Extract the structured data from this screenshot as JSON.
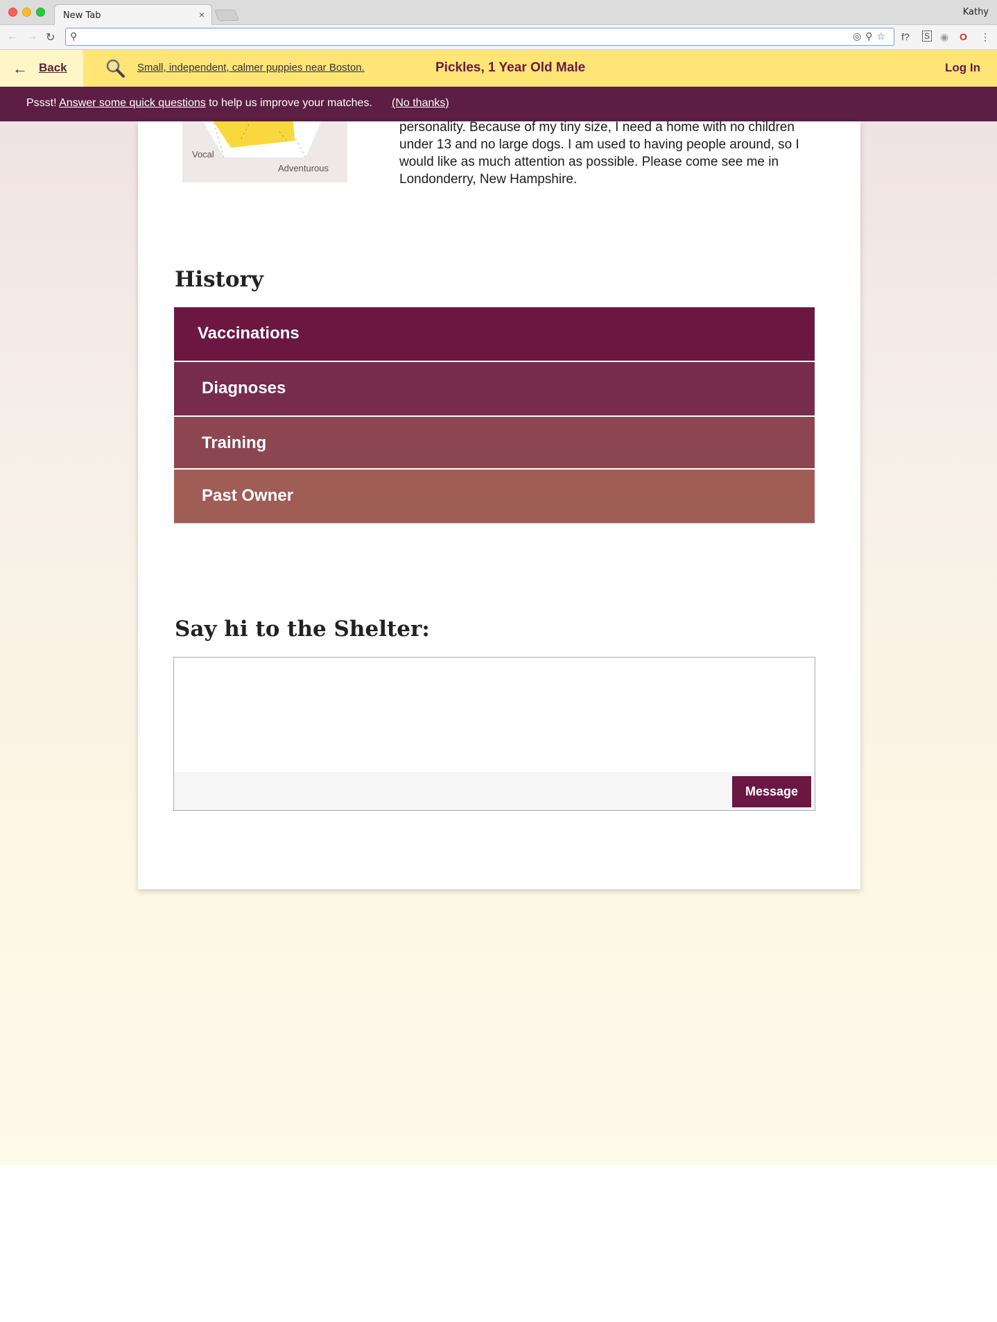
{
  "browser": {
    "tab_title": "New Tab",
    "tab_close": "×",
    "profile_name": "Kathy",
    "address_value": "",
    "extensions": [
      "f?",
      "S",
      "camera",
      "opera",
      "more"
    ]
  },
  "header": {
    "back_label": "Back",
    "search_query": "Small, independent, calmer puppies near Boston.",
    "pet_title": "Pickles, 1 Year Old Male",
    "login_label": "Log In"
  },
  "banner": {
    "prefix": "Pssst! ",
    "link_text": "Answer some quick questions",
    "suffix": " to help us improve your matches.",
    "dismiss": "(No thanks)"
  },
  "profile": {
    "radar_labels": {
      "vocal": "Vocal",
      "adventurous": "Adventurous"
    },
    "bio": "personality. Because of my tiny size, I need a home with no children under 13 and no large dogs. I am used to having people around, so I would like as much attention as possible. Please come see me in Londonderry, New Hampshire."
  },
  "history": {
    "heading": "History",
    "items": [
      {
        "label": "Vaccinations",
        "color": "#6b1742"
      },
      {
        "label": "Diagnoses",
        "color": "#772c4d"
      },
      {
        "label": "Training",
        "color": "#8c4651"
      },
      {
        "label": "Past Owner",
        "color": "#9f5d56"
      }
    ]
  },
  "shelter": {
    "heading": "Say hi to the Shelter:",
    "message_value": "",
    "message_button": "Message"
  },
  "colors": {
    "header_yellow": "#ffe576",
    "banner_purple": "#5c1e42",
    "brand_plum": "#6b1742"
  }
}
